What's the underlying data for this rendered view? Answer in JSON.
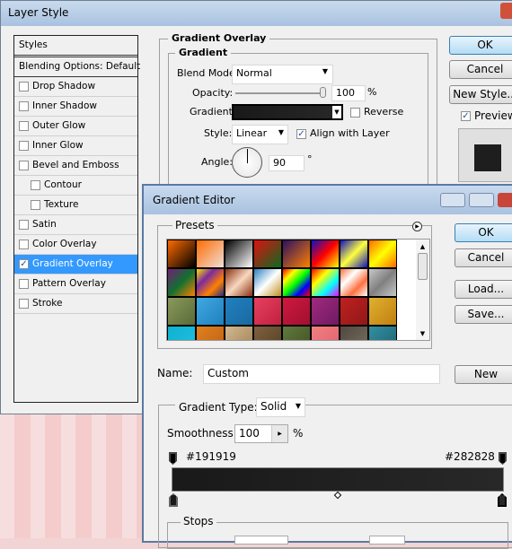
{
  "layer_style": {
    "title": "Layer Style",
    "styles_header": "Styles",
    "blending": "Blending Options: Default",
    "items": [
      {
        "label": "Drop Shadow",
        "checked": false,
        "indent": false
      },
      {
        "label": "Inner Shadow",
        "checked": false,
        "indent": false
      },
      {
        "label": "Outer Glow",
        "checked": false,
        "indent": false
      },
      {
        "label": "Inner Glow",
        "checked": false,
        "indent": false
      },
      {
        "label": "Bevel and Emboss",
        "checked": false,
        "indent": false
      },
      {
        "label": "Contour",
        "checked": false,
        "indent": true
      },
      {
        "label": "Texture",
        "checked": false,
        "indent": true
      },
      {
        "label": "Satin",
        "checked": false,
        "indent": false
      },
      {
        "label": "Color Overlay",
        "checked": false,
        "indent": false
      },
      {
        "label": "Gradient Overlay",
        "checked": true,
        "indent": false,
        "selected": true
      },
      {
        "label": "Pattern Overlay",
        "checked": false,
        "indent": false
      },
      {
        "label": "Stroke",
        "checked": false,
        "indent": false
      }
    ],
    "section_title": "Gradient Overlay",
    "group_title": "Gradient",
    "blend_mode_label": "Blend Mode:",
    "blend_mode": "Normal",
    "opacity_label": "Opacity:",
    "opacity": "100",
    "percent": "%",
    "gradient_label": "Gradient:",
    "reverse_label": "Reverse",
    "style_label": "Style:",
    "style": "Linear",
    "align_label": "Align with Layer",
    "angle_label": "Angle:",
    "angle": "90",
    "degree": "°",
    "ok": "OK",
    "cancel": "Cancel",
    "new_style": "New Style...",
    "preview": "Preview"
  },
  "gradient_editor": {
    "title": "Gradient Editor",
    "presets_label": "Presets",
    "ok": "OK",
    "cancel": "Cancel",
    "load": "Load...",
    "save": "Save...",
    "name_label": "Name:",
    "name": "Custom",
    "new": "New",
    "type_label": "Gradient Type:",
    "type": "Solid",
    "smoothness_label": "Smoothness:",
    "smoothness": "100",
    "percent": "%",
    "left_stop_color": "#191919",
    "right_stop_color": "#282828",
    "stops_label": "Stops",
    "presets": [
      [
        "#ff6a00",
        "#000000"
      ],
      [
        "#ff6a00",
        "#f0e0d8"
      ],
      [
        "#000000",
        "#ffffff"
      ],
      [
        "#e01010",
        "#0a6a20"
      ],
      [
        "#2a1060",
        "#ff8000"
      ],
      [
        "#1010c0",
        "#ff0000",
        "#ffff00"
      ],
      [
        "#1010c0",
        "#ffff40",
        "#1010c0"
      ],
      [
        "#ff6a00",
        "#ffff00",
        "#ff6a00"
      ],
      [
        "#7a1a7a",
        "#107030",
        "#ff8000"
      ],
      [
        "#ffe000",
        "#7a2aa0",
        "#ff8000",
        "#2a2a80"
      ],
      [
        "#8a3010",
        "#f8d8c0",
        "#8a3010"
      ],
      [
        "#2a80c0",
        "#ffffff",
        "#c09020"
      ],
      [
        "#ff0000",
        "#ffff00",
        "#00ff00",
        "#0000ff",
        "#ff0000"
      ],
      [
        "#ff0000",
        "#ffff00",
        "#00ffff",
        "#ff00ff"
      ],
      [
        "#ff7040",
        "#ffffff",
        "#ff7040",
        "#ffffff"
      ],
      [
        "#c8c8c8",
        "#808080",
        "#c8c8c8"
      ],
      [
        "#8a9a5a",
        "#5a6a3a"
      ],
      [
        "#40a8e0",
        "#2080c0"
      ],
      [
        "#2080c0",
        "#1a6aa0"
      ],
      [
        "#e84060",
        "#c02040"
      ],
      [
        "#d01840",
        "#a01030"
      ],
      [
        "#a02a80",
        "#701a60"
      ],
      [
        "#c02020",
        "#901818"
      ],
      [
        "#e0b030",
        "#c08010"
      ],
      [
        "#10b0d0",
        "#20c0e0"
      ],
      [
        "#e08020",
        "#c06010"
      ],
      [
        "#d0b890",
        "#a08050"
      ],
      [
        "#806040",
        "#504020"
      ],
      [
        "#607840",
        "#405020"
      ],
      [
        "#f08080",
        "#e06070"
      ],
      [
        "#504840",
        "#787060"
      ],
      [
        "#3090a0",
        "#206070"
      ]
    ]
  }
}
